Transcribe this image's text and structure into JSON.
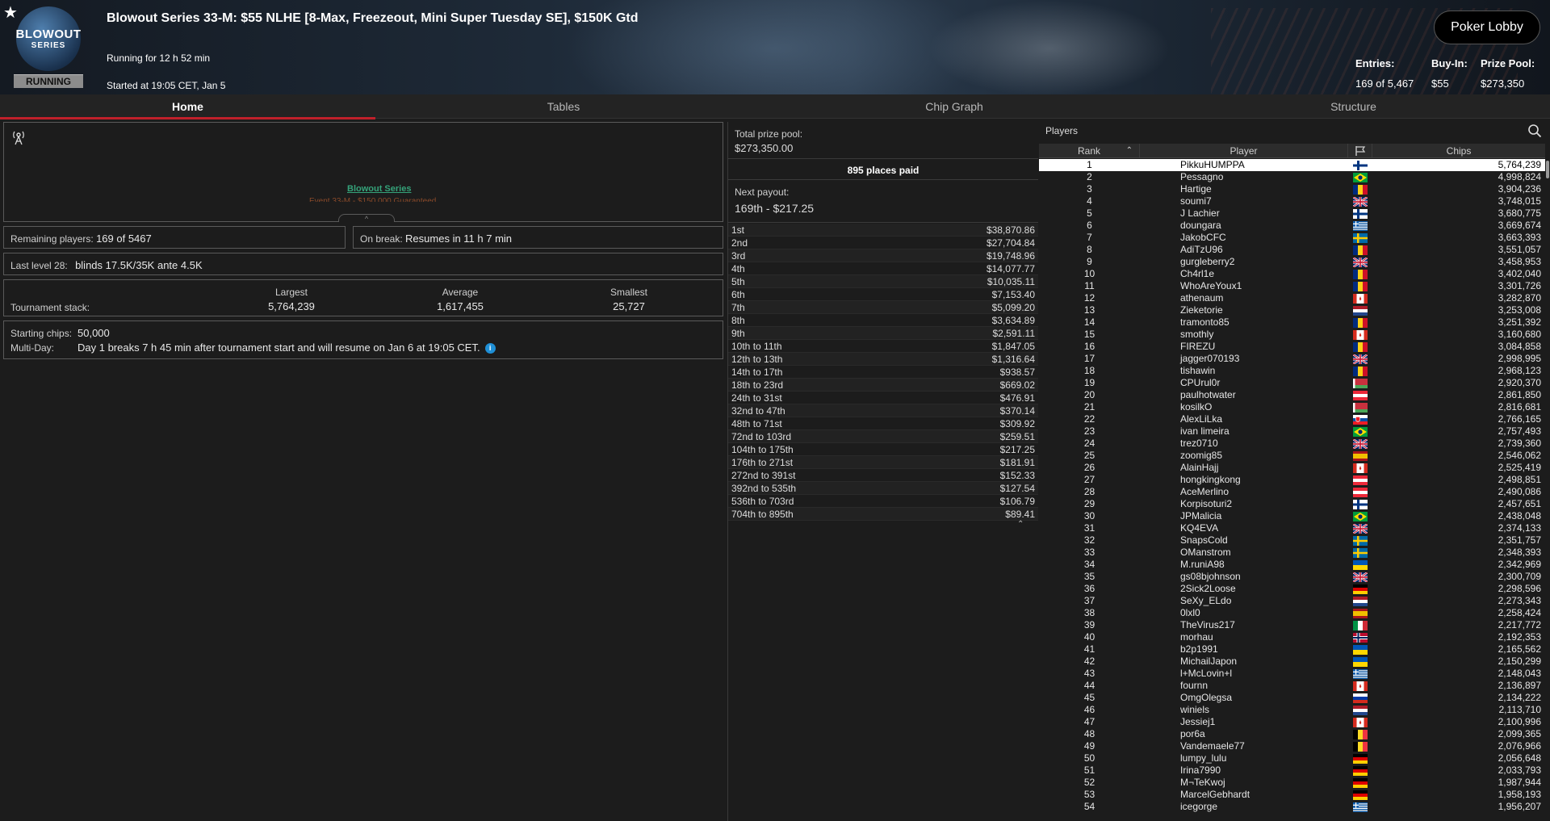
{
  "header": {
    "title": "Blowout Series 33-M: $55 NLHE [8-Max, Freezeout, Mini Super Tuesday SE], $150K Gtd",
    "running_for": "Running for 12 h 52 min",
    "started_at": "Started at 19:05 CET, Jan 5",
    "status": "RUNNING",
    "logo_line1": "BLOWOUT",
    "logo_line2": "SERIES",
    "lobby_button": "Poker Lobby",
    "entries_label": "Entries:",
    "entries_value": "169 of 5,467",
    "buyin_label": "Buy-In:",
    "buyin_value": "$55",
    "prize_label": "Prize Pool:",
    "prize_value": "$273,350"
  },
  "tabs": [
    "Home",
    "Tables",
    "Chip Graph",
    "Structure"
  ],
  "banner": {
    "series_link": "Blowout Series",
    "event_line": "Event 33-M - $150,000 Guaranteed"
  },
  "summary": {
    "remaining_label": "Remaining players:",
    "remaining_value": "169 of 5467",
    "onbreak_label": "On break:",
    "onbreak_value": "Resumes in 11 h 7 min",
    "lastlevel_label": "Last level 28:",
    "lastlevel_value": "blinds 17.5K/35K ante 4.5K",
    "stack_label": "Tournament stack:",
    "largest_label": "Largest",
    "largest_value": "5,764,239",
    "average_label": "Average",
    "average_value": "1,617,455",
    "smallest_label": "Smallest",
    "smallest_value": "25,727",
    "starting_label": "Starting chips:",
    "starting_value": "50,000",
    "multiday_label": "Multi-Day:",
    "multiday_value": "Day 1 breaks 7 h 45 min after tournament start and will resume on Jan 6 at 19:05 CET."
  },
  "prizes": {
    "total_label": "Total prize pool:",
    "total_value": "$273,350.00",
    "places_paid": "895 places paid",
    "next_label": "Next payout:",
    "next_value": "169th - $217.25",
    "payouts": [
      [
        "1st",
        "$38,870.86"
      ],
      [
        "2nd",
        "$27,704.84"
      ],
      [
        "3rd",
        "$19,748.96"
      ],
      [
        "4th",
        "$14,077.77"
      ],
      [
        "5th",
        "$10,035.11"
      ],
      [
        "6th",
        "$7,153.40"
      ],
      [
        "7th",
        "$5,099.20"
      ],
      [
        "8th",
        "$3,634.89"
      ],
      [
        "9th",
        "$2,591.11"
      ],
      [
        "10th to 11th",
        "$1,847.05"
      ],
      [
        "12th to 13th",
        "$1,316.64"
      ],
      [
        "14th to 17th",
        "$938.57"
      ],
      [
        "18th to 23rd",
        "$669.02"
      ],
      [
        "24th to 31st",
        "$476.91"
      ],
      [
        "32nd to 47th",
        "$370.14"
      ],
      [
        "48th to 71st",
        "$309.92"
      ],
      [
        "72nd to 103rd",
        "$259.51"
      ],
      [
        "104th to 175th",
        "$217.25"
      ],
      [
        "176th to 271st",
        "$181.91"
      ],
      [
        "272nd to 391st",
        "$152.33"
      ],
      [
        "392nd to 535th",
        "$127.54"
      ],
      [
        "536th to 703rd",
        "$106.79"
      ],
      [
        "704th to 895th",
        "$89.41"
      ]
    ]
  },
  "players": {
    "title": "Players",
    "col_rank": "Rank",
    "col_player": "Player",
    "col_chips": "Chips",
    "rows": [
      [
        "1",
        "PikkuHUMPPA",
        "fi",
        "5,764,239"
      ],
      [
        "2",
        "Pessagno",
        "br",
        "4,998,824"
      ],
      [
        "3",
        "Hartige",
        "ro",
        "3,904,236"
      ],
      [
        "4",
        "soumi7",
        "gb",
        "3,748,015"
      ],
      [
        "5",
        "J Lachier",
        "fi",
        "3,680,775"
      ],
      [
        "6",
        "doungara",
        "gr",
        "3,669,674"
      ],
      [
        "7",
        "JakobCFC",
        "se",
        "3,663,393"
      ],
      [
        "8",
        "AdiTzU96",
        "ro",
        "3,551,057"
      ],
      [
        "9",
        "gurgleberry2",
        "gb",
        "3,458,953"
      ],
      [
        "10",
        "Ch4rl1e",
        "ro",
        "3,402,040"
      ],
      [
        "11",
        "WhoAreYoux1",
        "ro",
        "3,301,726"
      ],
      [
        "12",
        "athenaum",
        "ca",
        "3,282,870"
      ],
      [
        "13",
        "Zieketorie",
        "nl",
        "3,253,008"
      ],
      [
        "14",
        "tramonto85",
        "ro",
        "3,251,392"
      ],
      [
        "15",
        "smothly",
        "ca",
        "3,160,680"
      ],
      [
        "16",
        "FIREZU",
        "ro",
        "3,084,858"
      ],
      [
        "17",
        "jagger070193",
        "gb",
        "2,998,995"
      ],
      [
        "18",
        "tishawin",
        "ro",
        "2,968,123"
      ],
      [
        "19",
        "CPUrul0r",
        "by",
        "2,920,370"
      ],
      [
        "20",
        "paulhotwater",
        "at",
        "2,861,850"
      ],
      [
        "21",
        "kosilkO",
        "by",
        "2,816,681"
      ],
      [
        "22",
        "AlexLiLka",
        "sk",
        "2,766,165"
      ],
      [
        "23",
        "ivan limeira",
        "br",
        "2,757,493"
      ],
      [
        "24",
        "trez0710",
        "gb",
        "2,739,360"
      ],
      [
        "25",
        "zoomig85",
        "es",
        "2,546,062"
      ],
      [
        "26",
        "AlainHajj",
        "ca",
        "2,525,419"
      ],
      [
        "27",
        "hongkingkong",
        "at",
        "2,498,851"
      ],
      [
        "28",
        "AceMerlino",
        "at",
        "2,490,086"
      ],
      [
        "29",
        "Korpisoturi2",
        "fi",
        "2,457,651"
      ],
      [
        "30",
        "JPMalicia",
        "br",
        "2,438,048"
      ],
      [
        "31",
        "KQ4EVA",
        "gb",
        "2,374,133"
      ],
      [
        "32",
        "SnapsCold",
        "se",
        "2,351,757"
      ],
      [
        "33",
        "OManstrom",
        "se",
        "2,348,393"
      ],
      [
        "34",
        "M.runiA98",
        "ua",
        "2,342,969"
      ],
      [
        "35",
        "gs08bjohnson",
        "gb",
        "2,300,709"
      ],
      [
        "36",
        "2Sick2Loose",
        "de",
        "2,298,596"
      ],
      [
        "37",
        "SeXy_ELdo",
        "nl",
        "2,273,343"
      ],
      [
        "38",
        "0lxl0",
        "es",
        "2,258,424"
      ],
      [
        "39",
        "TheVirus217",
        "it",
        "2,217,772"
      ],
      [
        "40",
        "morhau",
        "no",
        "2,192,353"
      ],
      [
        "41",
        "b2p1991",
        "ua",
        "2,165,562"
      ],
      [
        "42",
        "MichailJapon",
        "ua",
        "2,150,299"
      ],
      [
        "43",
        "l+McLovin+l",
        "gr",
        "2,148,043"
      ],
      [
        "44",
        "fournn",
        "ca",
        "2,136,897"
      ],
      [
        "45",
        "OmgOlegsa",
        "ru",
        "2,134,222"
      ],
      [
        "46",
        "winiels",
        "nl",
        "2,113,710"
      ],
      [
        "47",
        "Jessiej1",
        "ca",
        "2,100,996"
      ],
      [
        "48",
        "por6a",
        "be",
        "2,099,365"
      ],
      [
        "49",
        "Vandemaele77",
        "be",
        "2,076,966"
      ],
      [
        "50",
        "lumpy_lulu",
        "de",
        "2,056,648"
      ],
      [
        "51",
        "Irina7990",
        "de",
        "2,033,793"
      ],
      [
        "52",
        "M¬TeKwoj",
        "de",
        "1,987,944"
      ],
      [
        "53",
        "MarcelGebhardt",
        "de",
        "1,958,193"
      ],
      [
        "54",
        "icegorge",
        "gr",
        "1,956,207"
      ]
    ]
  }
}
